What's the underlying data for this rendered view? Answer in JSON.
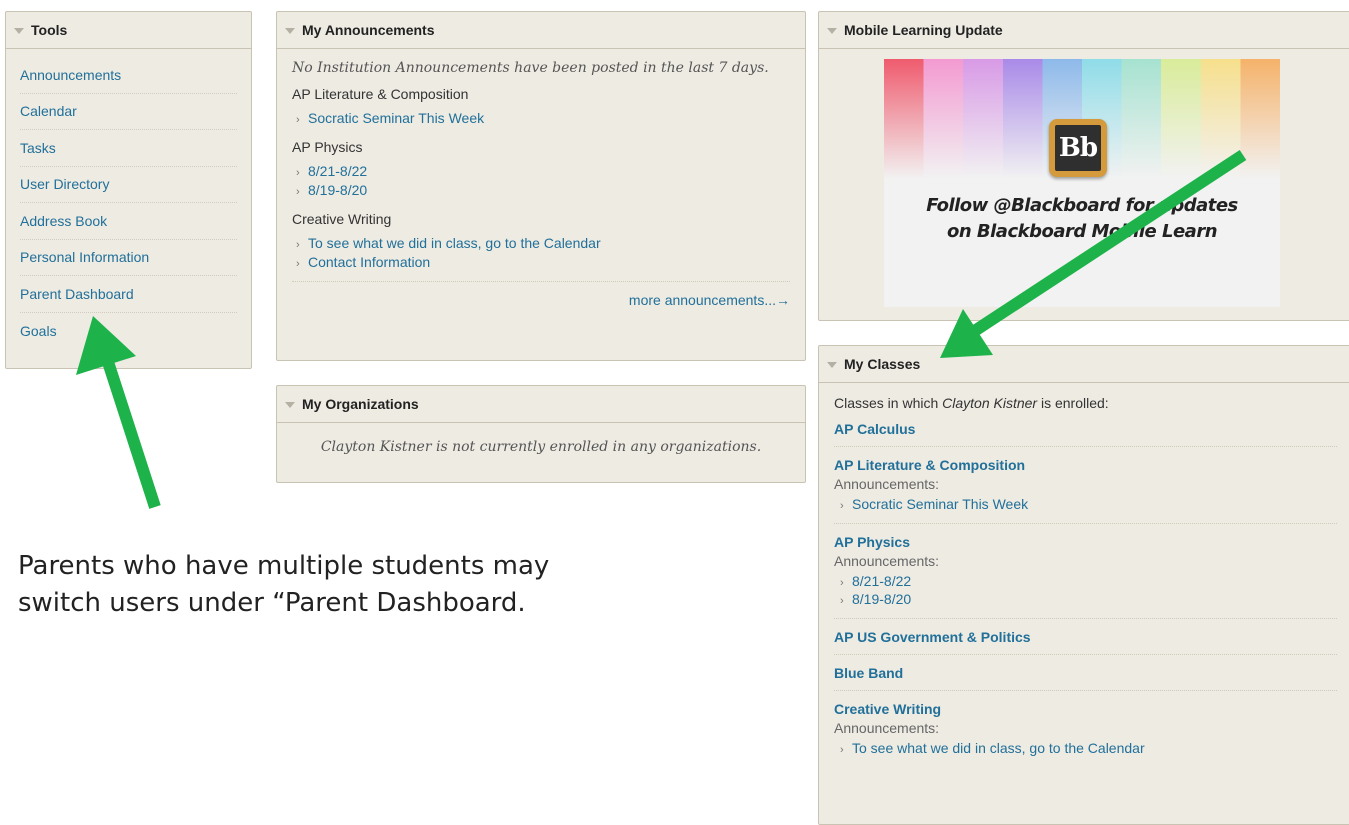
{
  "tools": {
    "title": "Tools",
    "items": [
      "Announcements",
      "Calendar",
      "Tasks",
      "User Directory",
      "Address Book",
      "Personal Information",
      "Parent Dashboard",
      "Goals"
    ]
  },
  "announcements": {
    "title": "My Announcements",
    "institution_notice": "No Institution Announcements have been posted in the last 7 days.",
    "groups": [
      {
        "course": "AP Literature & Composition",
        "items": [
          "Socratic Seminar This Week"
        ]
      },
      {
        "course": "AP Physics",
        "items": [
          "8/21-8/22",
          "8/19-8/20"
        ]
      },
      {
        "course": "Creative Writing",
        "items": [
          "To see what we did in class, go to the Calendar",
          "Contact Information"
        ]
      }
    ],
    "more_link": "more announcements...→"
  },
  "organizations": {
    "title": "My Organizations",
    "message": "Clayton Kistner is not currently enrolled in any organizations."
  },
  "mobile": {
    "title": "Mobile Learning Update",
    "logo_letters": "Bb",
    "banner_line1": "Follow @Blackboard for updates",
    "banner_line2": "on Blackboard Mobile Learn"
  },
  "classes": {
    "title": "My Classes",
    "intro_prefix": "Classes in which ",
    "intro_name": "Clayton Kistner",
    "intro_suffix": " is enrolled:",
    "announcements_label": "Announcements:",
    "list": [
      {
        "name": "AP Calculus",
        "announcements": []
      },
      {
        "name": "AP Literature & Composition",
        "announcements": [
          "Socratic Seminar This Week"
        ]
      },
      {
        "name": "AP Physics",
        "announcements": [
          "8/21-8/22",
          "8/19-8/20"
        ]
      },
      {
        "name": "AP US Government & Politics",
        "announcements": []
      },
      {
        "name": "Blue Band",
        "announcements": []
      },
      {
        "name": "Creative Writing",
        "announcements": [
          "To see what we did in class, go to the Calendar"
        ]
      }
    ]
  },
  "caption": {
    "line1": "Parents who have multiple students may",
    "line2": "switch users under “Parent Dashboard."
  },
  "colors": {
    "arrow": "#1db34a",
    "link": "#21709a",
    "module_bg": "#eeebe3"
  },
  "icons": {
    "collapse": "collapse-triangle-icon",
    "bullet": "chevron-right-icon",
    "annotation": "green-arrow-icon"
  }
}
